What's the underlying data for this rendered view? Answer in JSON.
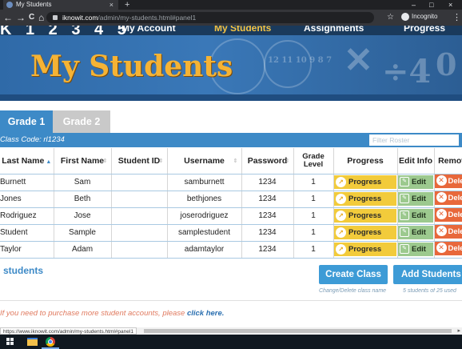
{
  "browser": {
    "tab_title": "My Students",
    "tab_close": "×",
    "new_tab": "+",
    "window_controls": [
      "–",
      "□",
      "×"
    ],
    "nav": {
      "back": "←",
      "forward": "→",
      "reload": "C",
      "home": "⌂"
    },
    "url_host": "iknowit.com",
    "url_path": "/admin/my-students.html#panel1",
    "star": "☆",
    "incognito_label": "Incognito",
    "menu": "⋮"
  },
  "site_nav": {
    "numbers": "K 1 2 3 4 5",
    "links": [
      "My Account",
      "My Students",
      "Assignments",
      "Progress"
    ],
    "active": "My Students"
  },
  "banner": {
    "title": "My Students",
    "decor_numbers": "12 11 10 9 8 7"
  },
  "grade_tabs": [
    {
      "label": "Grade 1",
      "active": true
    },
    {
      "label": "Grade 2",
      "active": false
    }
  ],
  "class_code": "Class Code: rl1234",
  "filter_placeholder": "Filter Roster",
  "table": {
    "headers": [
      "Last Name",
      "First Name",
      "Student ID",
      "Username",
      "Password",
      "Grade Level",
      "Progress",
      "Edit Info",
      "Remove"
    ],
    "rows": [
      {
        "last": "Burnett",
        "first": "Sam",
        "id": "",
        "username": "samburnett",
        "password": "1234",
        "grade": "1"
      },
      {
        "last": "Jones",
        "first": "Beth",
        "id": "",
        "username": "bethjones",
        "password": "1234",
        "grade": "1"
      },
      {
        "last": "Rodriguez",
        "first": "Jose",
        "id": "",
        "username": "joserodriguez",
        "password": "1234",
        "grade": "1"
      },
      {
        "last": "Student",
        "first": "Sample",
        "id": "",
        "username": "samplestudent",
        "password": "1234",
        "grade": "1"
      },
      {
        "last": "Taylor",
        "first": "Adam",
        "id": "",
        "username": "adamtaylor",
        "password": "1234",
        "grade": "1"
      }
    ],
    "progress_label": "Progress",
    "edit_label": "Edit",
    "delete_label": "Delete"
  },
  "footer": {
    "students_count": "students",
    "create_class": "Create Class",
    "create_note": "Change/Delete class name",
    "add_student": "Add Students",
    "add_note": "5 students of 25 used",
    "purchase_text": "If you need to purchase more student accounts, please ",
    "purchase_link": "click here."
  },
  "status_url": "https://www.iknowit.com/admin/my-students.html#panel1",
  "colors": {
    "accent_blue": "#3d8ac7",
    "banner_gold": "#f5b335",
    "progress_yellow": "#f2cb3b",
    "edit_green": "#9cc98e",
    "delete_orange": "#e8683b"
  }
}
